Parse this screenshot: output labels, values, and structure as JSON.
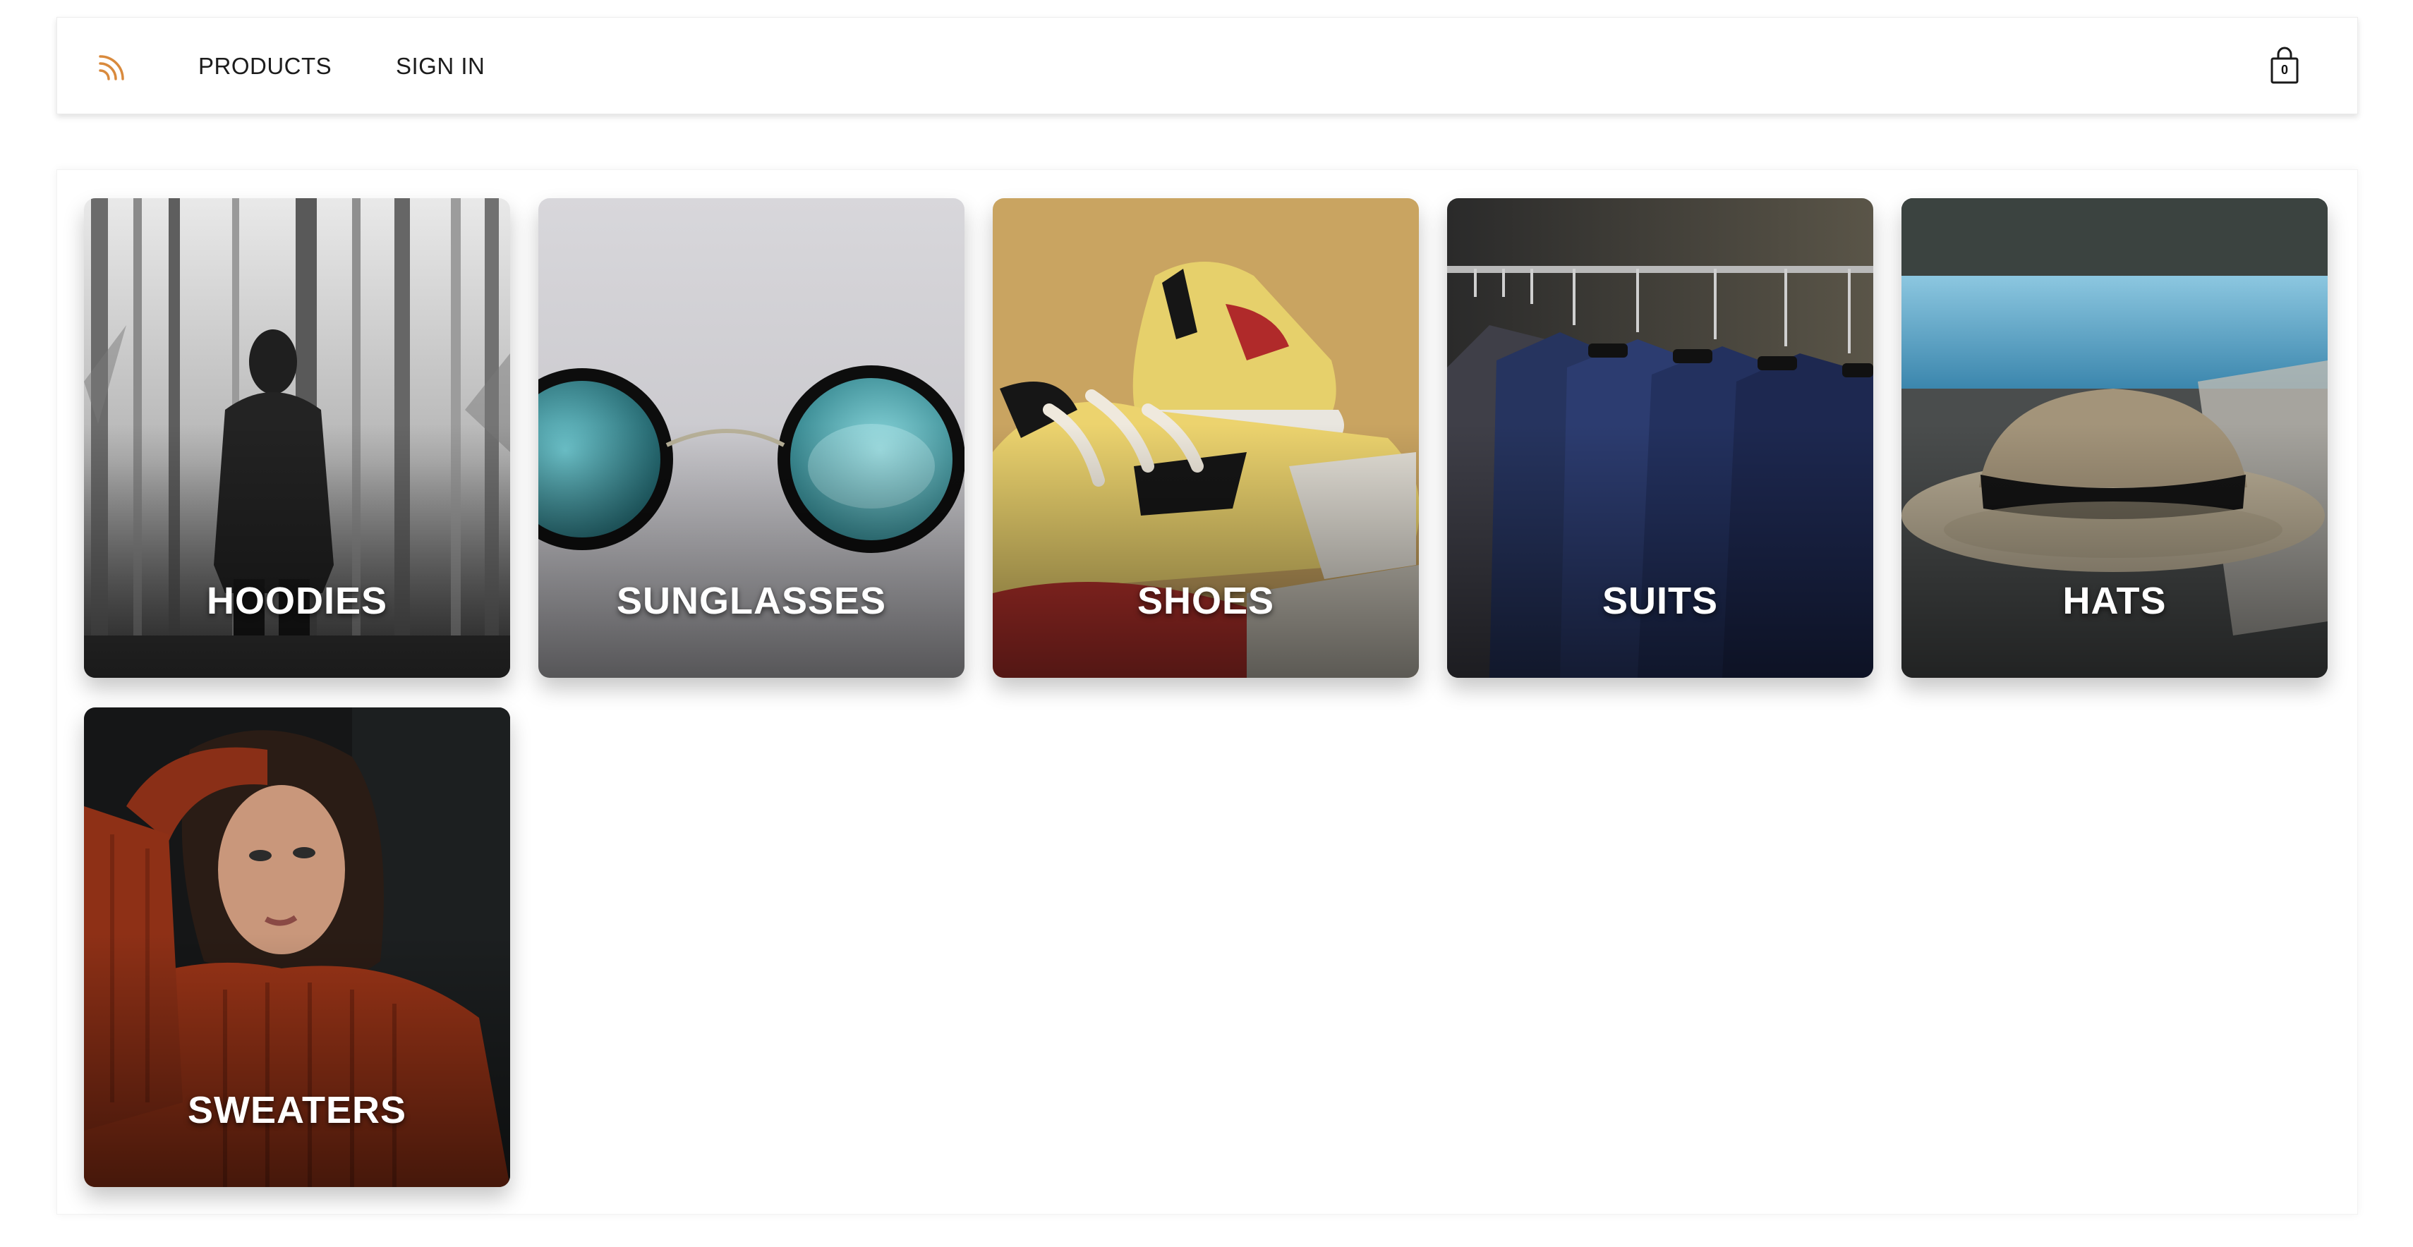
{
  "header": {
    "logo_icon": "rss-icon",
    "accent_color": "#d98a3d",
    "nav": {
      "products": "PRODUCTS",
      "sign_in": "SIGN IN"
    },
    "cart": {
      "icon": "shopping-bag-icon",
      "count": "0"
    }
  },
  "categories": [
    {
      "label": "HOODIES",
      "photo": "hoodie-in-forest"
    },
    {
      "label": "SUNGLASSES",
      "photo": "round-sunglasses"
    },
    {
      "label": "SHOES",
      "photo": "sneakers"
    },
    {
      "label": "SUITS",
      "photo": "suits-on-rack"
    },
    {
      "label": "HATS",
      "photo": "straw-hat-by-pool"
    },
    {
      "label": "SWEATERS",
      "photo": "woman-in-red-sweater"
    }
  ]
}
